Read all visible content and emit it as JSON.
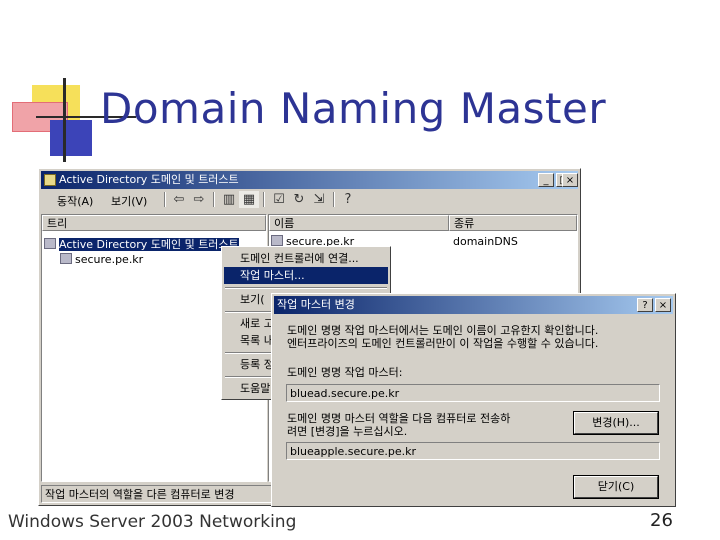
{
  "slide": {
    "title": "Domain Naming Master",
    "footer_left": "Windows  Server 2003 Networking",
    "page_number": "26"
  },
  "window": {
    "title": "Active Directory 도메인 및 트러스트",
    "min_label": "_",
    "max_label": "□",
    "close_label": "×",
    "menu": [
      "동작(A)",
      "보기(V)"
    ],
    "toolbar_icons": [
      "back-icon",
      "forward-icon",
      "up-icon",
      "show-tree-icon",
      "properties-icon",
      "refresh-icon",
      "export-icon",
      "help-icon"
    ],
    "toolbar_glyphs": [
      "⇦",
      "⇨",
      "▥",
      "▦",
      "☑",
      "↻",
      "⇲",
      "?"
    ],
    "tree_header": "트리",
    "tree_items": [
      "Active Directory 도메인 및 트러스트",
      "secure.pe.kr"
    ],
    "list_columns": [
      "이름",
      "종류"
    ],
    "list_rows": [
      {
        "name": "secure.pe.kr",
        "type": "domainDNS"
      }
    ],
    "status_text": "작업 마스터의 역할을 다른 컴퓨터로 변경"
  },
  "context_menu": {
    "items": [
      "도메인 컨트롤러에 연결...",
      "작업 마스터...",
      "보기(",
      "새로 고",
      "목록 내",
      "등록 정",
      "도움말"
    ],
    "selected": "작업 마스터..."
  },
  "dialog": {
    "title": "작업 마스터 변경",
    "help_label": "?",
    "close_label": "×",
    "intro_line1": "도메인 명명 작업 마스터에서는 도메인 이름이 고유한지 확인합니다.",
    "intro_line2": "엔터프라이즈의 도메인 컨트롤러만이 이 작업을 수행할 수 있습니다.",
    "current_label": "도메인 명명 작업 마스터:",
    "current_value": "bluead.secure.pe.kr",
    "transfer_line1": "도메인 명명 마스터 역할을 다음 컴퓨터로 전송하",
    "transfer_line2": "려면 [변경]을 누르십시오.",
    "change_button": "변경(H)...",
    "target_value": "blueapple.secure.pe.kr",
    "close_button": "닫기(C)"
  }
}
